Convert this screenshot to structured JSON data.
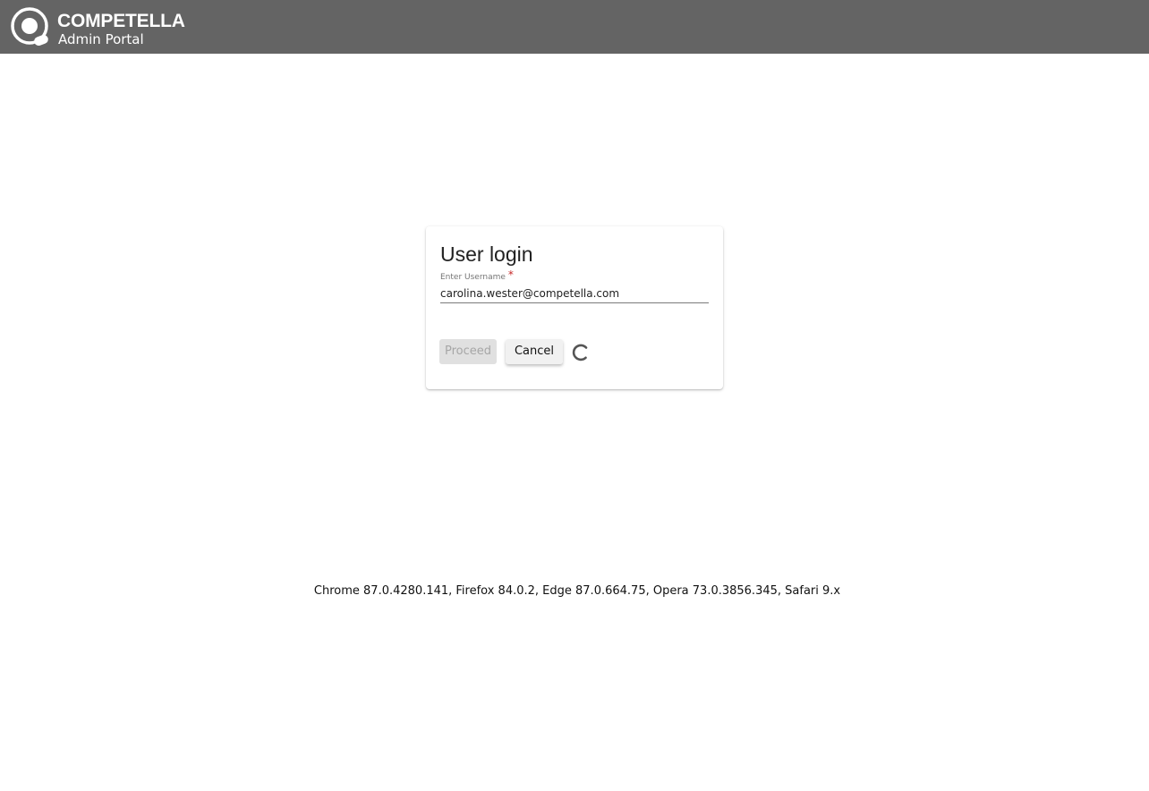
{
  "header": {
    "brand_name": "COMPETELLA",
    "brand_subtitle": "Admin Portal",
    "logo_icon": "competella-logo-icon",
    "background_color": "#646464"
  },
  "login": {
    "title": "User login",
    "username_label": "Enter Username",
    "required_marker": "*",
    "username_value": "carolina.wester@competella.com",
    "proceed_label": "Proceed",
    "cancel_label": "Cancel",
    "loading_icon": "spinner-icon"
  },
  "footer": {
    "browser_versions": "Chrome 87.0.4280.141, Firefox 84.0.2, Edge 87.0.664.75, Opera 73.0.3856.345, Safari 9.x"
  }
}
